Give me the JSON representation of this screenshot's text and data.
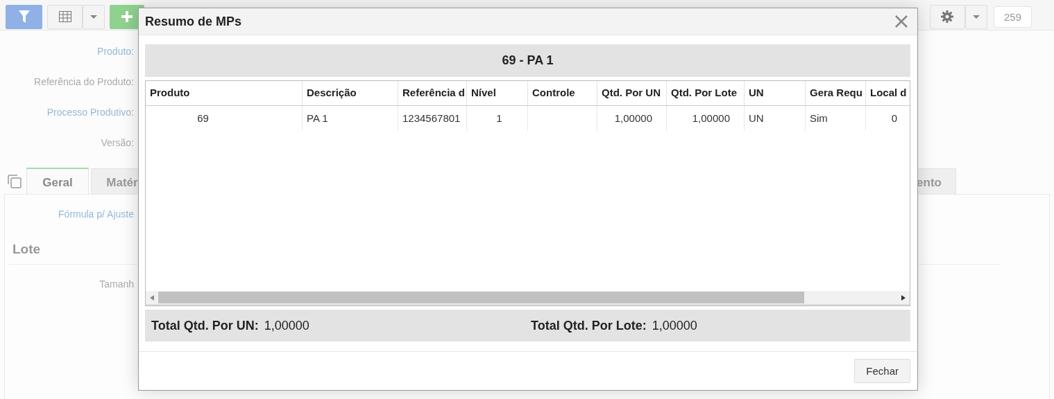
{
  "toolbar": {
    "counter": "259"
  },
  "form": {
    "fields": [
      {
        "label": "Produto:",
        "kind": "link"
      },
      {
        "label": "Referência do Produto:",
        "kind": "plain"
      },
      {
        "label": "Processo Produtivo:",
        "kind": "link"
      },
      {
        "label": "Versão:",
        "kind": "plain"
      }
    ]
  },
  "tabs": [
    {
      "label": "Geral",
      "selected": true
    },
    {
      "label": "Matér",
      "selected": false
    },
    {
      "label": "ento",
      "selected": false
    }
  ],
  "tab_panel": {
    "formula_label": "Fórmula p/ Ajuste",
    "section_title": "Lote",
    "size_label": "Tamanh"
  },
  "dialog": {
    "title": "Resumo de MPs",
    "group_header": "69 - PA 1",
    "table": {
      "columns": [
        "Produto",
        "Descrição",
        "Referência d",
        "Nível",
        "Controle",
        "Qtd. Por UN",
        "Qtd. Por Lote",
        "UN",
        "Gera Requ",
        "Local d"
      ],
      "rows": [
        [
          "69",
          "PA 1",
          "1234567801",
          "1",
          null,
          "1,00000",
          "1,00000",
          "UN",
          "Sim",
          "0"
        ]
      ]
    },
    "totals": [
      {
        "label": "Total Qtd. Por UN:",
        "value": "1,00000"
      },
      {
        "label": "Total Qtd. Por Lote:",
        "value": "1,00000"
      }
    ],
    "buttons": [
      "Fechar"
    ]
  }
}
